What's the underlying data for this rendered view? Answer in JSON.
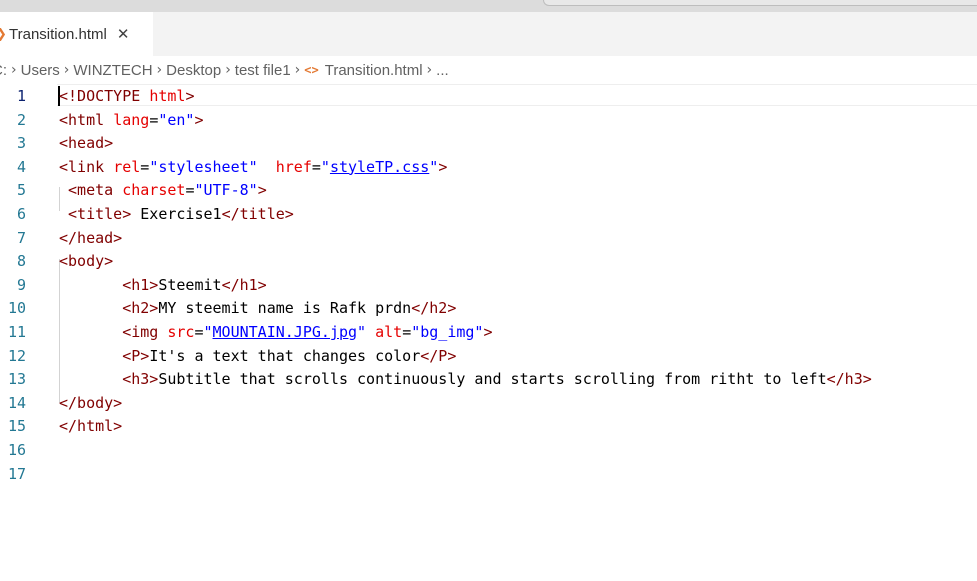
{
  "tab": {
    "file_icon": "❯",
    "label": "Transition.html",
    "close_icon": "✕"
  },
  "breadcrumb": {
    "items": [
      "C:",
      "Users",
      "WINZTECH",
      "Desktop",
      "test file1",
      "Transition.html",
      "..."
    ],
    "separator": "›",
    "file_icon": "<>"
  },
  "editor": {
    "colors": {
      "tag": "#800000",
      "attribute": "#e50000",
      "string": "#0000ff",
      "line_number": "#237893",
      "active_line_number": "#0b216f"
    },
    "lines": [
      {
        "n": "1",
        "tokens": [
          [
            "t",
            "<!DOCTYPE"
          ],
          [
            "p",
            " "
          ],
          [
            "a",
            "html"
          ],
          [
            "t",
            ">"
          ]
        ]
      },
      {
        "n": "2",
        "tokens": [
          [
            "t",
            "<html"
          ],
          [
            "p",
            " "
          ],
          [
            "a",
            "lang"
          ],
          [
            "p",
            "="
          ],
          [
            "s",
            "\"en\""
          ],
          [
            "t",
            ">"
          ]
        ]
      },
      {
        "n": "3",
        "tokens": [
          [
            "t",
            "<head>"
          ]
        ]
      },
      {
        "n": "4",
        "tokens": [
          [
            "t",
            "<link"
          ],
          [
            "p",
            " "
          ],
          [
            "a",
            "rel"
          ],
          [
            "p",
            "="
          ],
          [
            "s",
            "\"stylesheet\""
          ],
          [
            "p",
            "  "
          ],
          [
            "a",
            "href"
          ],
          [
            "p",
            "="
          ],
          [
            "s",
            "\""
          ],
          [
            "su",
            "styleTP.css"
          ],
          [
            "s",
            "\""
          ],
          [
            "t",
            ">"
          ]
        ]
      },
      {
        "n": "5",
        "tokens": [
          [
            "p",
            " "
          ],
          [
            "t",
            "<meta"
          ],
          [
            "p",
            " "
          ],
          [
            "a",
            "charset"
          ],
          [
            "p",
            "="
          ],
          [
            "s",
            "\"UTF-8\""
          ],
          [
            "t",
            ">"
          ]
        ]
      },
      {
        "n": "6",
        "tokens": [
          [
            "p",
            " "
          ],
          [
            "t",
            "<title>"
          ],
          [
            "p",
            " Exercise1"
          ],
          [
            "t",
            "</title>"
          ]
        ]
      },
      {
        "n": "7",
        "tokens": [
          [
            "t",
            "</head>"
          ]
        ]
      },
      {
        "n": "8",
        "tokens": [
          [
            "t",
            "<body>"
          ]
        ]
      },
      {
        "n": "9",
        "tokens": [
          [
            "p",
            "       "
          ],
          [
            "t",
            "<h1>"
          ],
          [
            "p",
            "Steemit"
          ],
          [
            "t",
            "</h1>"
          ]
        ]
      },
      {
        "n": "10",
        "tokens": [
          [
            "p",
            "       "
          ],
          [
            "t",
            "<h2>"
          ],
          [
            "p",
            "MY steemit name is Rafk prdn"
          ],
          [
            "t",
            "</h2>"
          ]
        ]
      },
      {
        "n": "11",
        "tokens": [
          [
            "p",
            "       "
          ],
          [
            "t",
            "<img"
          ],
          [
            "p",
            " "
          ],
          [
            "a",
            "src"
          ],
          [
            "p",
            "="
          ],
          [
            "s",
            "\""
          ],
          [
            "su",
            "MOUNTAIN.JPG.jpg"
          ],
          [
            "s",
            "\""
          ],
          [
            "p",
            " "
          ],
          [
            "a",
            "alt"
          ],
          [
            "p",
            "="
          ],
          [
            "s",
            "\"bg_img\""
          ],
          [
            "t",
            ">"
          ]
        ]
      },
      {
        "n": "12",
        "tokens": [
          [
            "p",
            "       "
          ],
          [
            "t",
            "<P>"
          ],
          [
            "p",
            "It's a text that changes color"
          ],
          [
            "t",
            "</P>"
          ]
        ]
      },
      {
        "n": "13",
        "tokens": [
          [
            "p",
            "       "
          ],
          [
            "t",
            "<h3>"
          ],
          [
            "p",
            "Subtitle that scrolls continuously and starts scrolling from ritht to left"
          ],
          [
            "t",
            "</h3>"
          ]
        ]
      },
      {
        "n": "14",
        "tokens": [
          [
            "t",
            "</body>"
          ]
        ]
      },
      {
        "n": "15",
        "tokens": [
          [
            "t",
            "</html>"
          ]
        ]
      },
      {
        "n": "16",
        "tokens": []
      },
      {
        "n": "17",
        "tokens": []
      }
    ]
  }
}
